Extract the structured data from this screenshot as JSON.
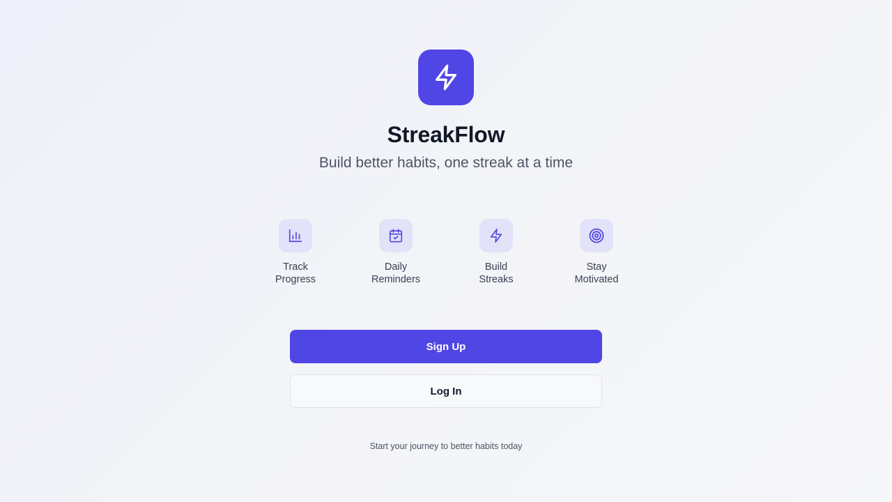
{
  "app": {
    "logo_icon": "lightning-bolt-icon",
    "title": "StreakFlow",
    "tagline": "Build better habits, one streak at a time"
  },
  "colors": {
    "brand": "#5046e5",
    "icon_tile": "#e2e2f8"
  },
  "features": [
    {
      "icon": "bar-chart-icon",
      "line1": "Track",
      "line2": "Progress"
    },
    {
      "icon": "calendar-check-icon",
      "line1": "Daily",
      "line2": "Reminders"
    },
    {
      "icon": "lightning-bolt-icon",
      "line1": "Build",
      "line2": "Streaks"
    },
    {
      "icon": "target-icon",
      "line1": "Stay",
      "line2": "Motivated"
    }
  ],
  "actions": {
    "signup_label": "Sign Up",
    "login_label": "Log In"
  },
  "footer": {
    "note": "Start your journey to better habits today"
  }
}
